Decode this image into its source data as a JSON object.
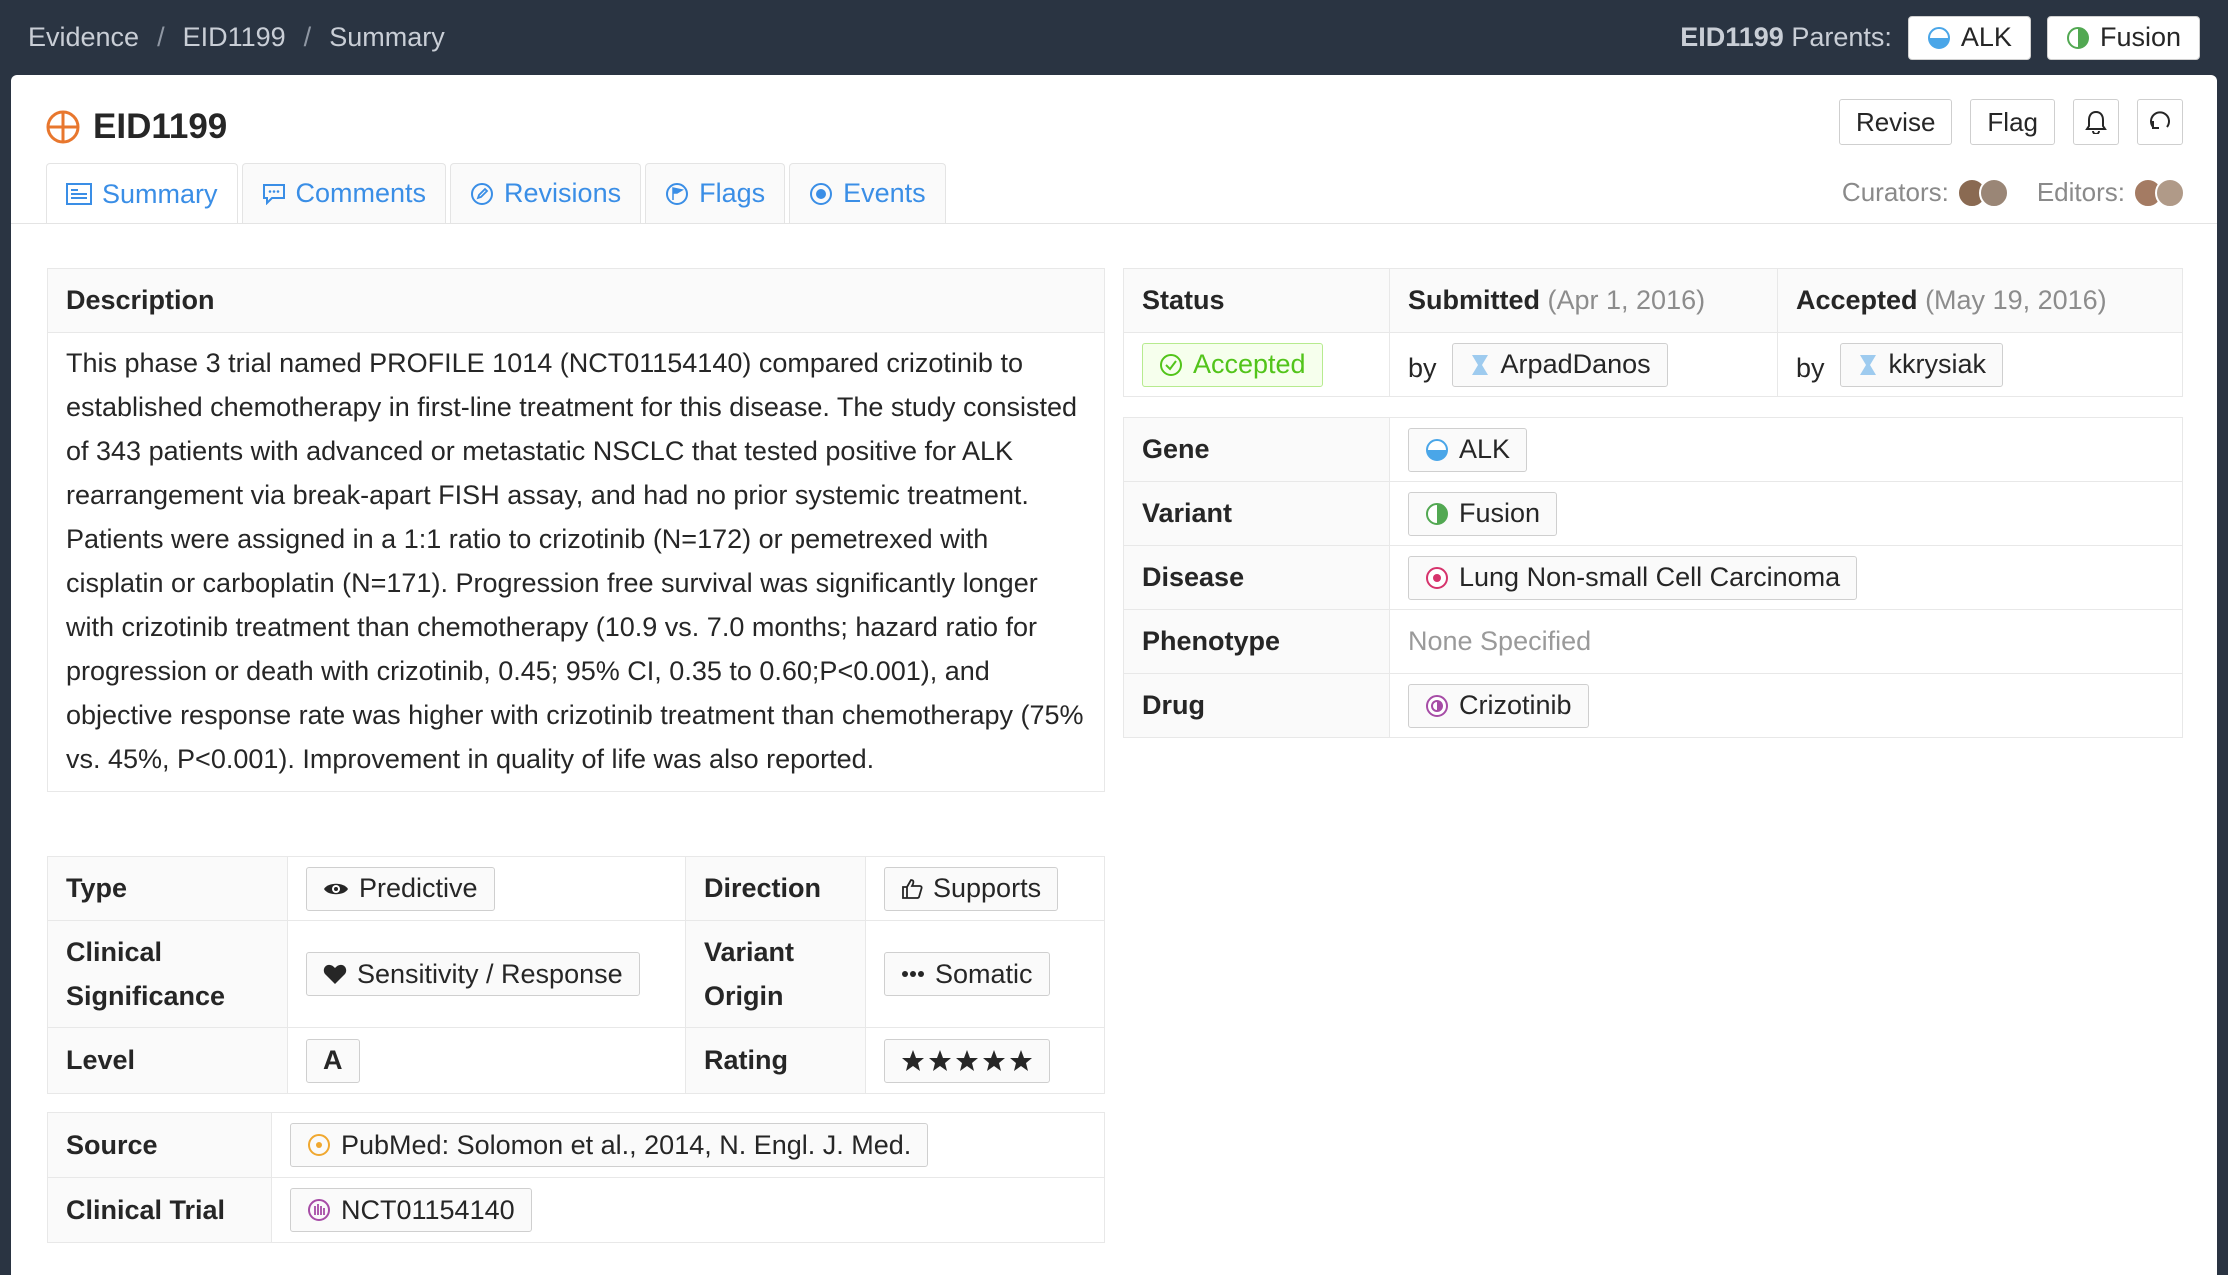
{
  "breadcrumb": [
    "Evidence",
    "/",
    "EID1199",
    "/",
    "Summary"
  ],
  "parents": {
    "id": "EID1199",
    "label": "Parents:",
    "items": [
      "ALK",
      "Fusion"
    ]
  },
  "header": {
    "title": "EID1199",
    "revise": "Revise",
    "flag": "Flag"
  },
  "tabs": [
    "Summary",
    "Comments",
    "Revisions",
    "Flags",
    "Events"
  ],
  "people": {
    "curators": "Curators:",
    "editors": "Editors:"
  },
  "description": {
    "header": "Description",
    "text": "This phase 3 trial named PROFILE 1014 (NCT01154140) compared crizotinib to established chemotherapy in first-line treatment for this disease. The study consisted of 343 patients with advanced or metastatic NSCLC that tested positive for ALK rearrangement via break-apart FISH assay, and had no prior systemic treatment. Patients were assigned in a 1:1 ratio to crizotinib (N=172) or pemetrexed with cisplatin or carboplatin (N=171). Progression free survival was significantly longer with crizotinib treatment than chemotherapy (10.9 vs. 7.0 months; hazard ratio for progression or death with crizotinib, 0.45; 95% CI, 0.35 to 0.60;P<0.001), and objective response rate was higher with crizotinib treatment than chemotherapy (75% vs. 45%, P<0.001). Improvement in quality of life was also reported."
  },
  "attributes": {
    "type_label": "Type",
    "type_value": "Predictive",
    "direction_label": "Direction",
    "direction_value": "Supports",
    "significance_label_1": "Clinical",
    "significance_label_2": "Significance",
    "significance_value": "Sensitivity / Response",
    "origin_label_1": "Variant",
    "origin_label_2": "Origin",
    "origin_value": "Somatic",
    "level_label": "Level",
    "level_value": "A",
    "rating_label": "Rating",
    "rating_value": 5,
    "rating_max": 5
  },
  "sources": {
    "source_label": "Source",
    "source_value": "PubMed: Solomon et al., 2014, N. Engl. J. Med.",
    "trial_label": "Clinical Trial",
    "trial_value": "NCT01154140"
  },
  "status": {
    "status_label": "Status",
    "status_value": "Accepted",
    "submitted_label": "Submitted",
    "submitted_date": "(Apr 1, 2016)",
    "submitted_by": "by",
    "submitted_user": "ArpadDanos",
    "accepted_label": "Accepted",
    "accepted_date": "(May 19, 2016)",
    "accepted_by": "by",
    "accepted_user": "kkrysiak"
  },
  "entities": {
    "gene_label": "Gene",
    "gene_value": "ALK",
    "variant_label": "Variant",
    "variant_value": "Fusion",
    "disease_label": "Disease",
    "disease_value": "Lung Non-small Cell Carcinoma",
    "phenotype_label": "Phenotype",
    "phenotype_value": "None Specified",
    "drug_label": "Drug",
    "drug_value": "Crizotinib"
  },
  "colors": {
    "accent": "#3a8ee6",
    "accepted": "#52c41a",
    "topbar": "#2a3442",
    "evidence_icon": "#e8772e"
  }
}
